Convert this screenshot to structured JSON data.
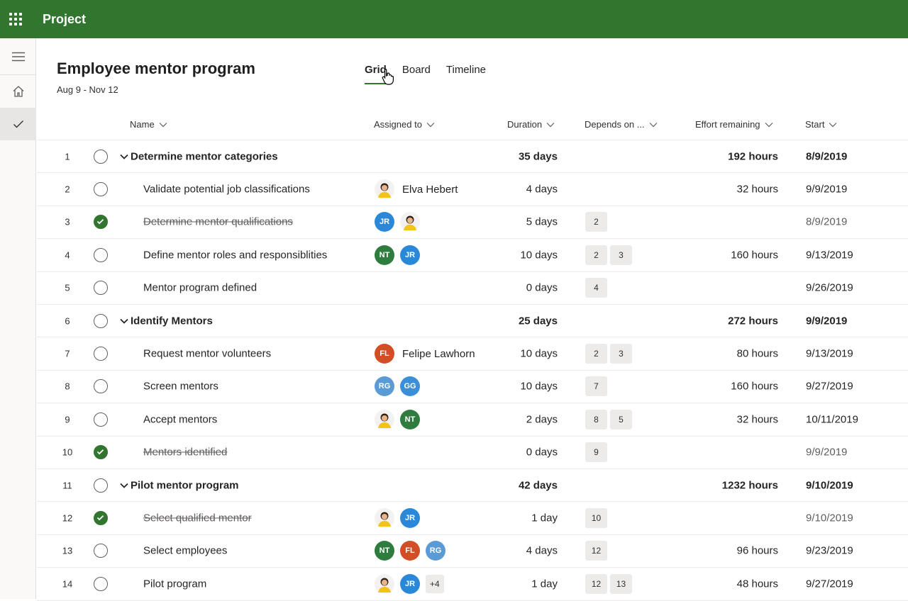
{
  "app": {
    "title": "Project"
  },
  "plan": {
    "title": "Employee mentor program",
    "dates": "Aug 9 - Nov 12"
  },
  "tabs": [
    {
      "label": "Grid",
      "active": true
    },
    {
      "label": "Board"
    },
    {
      "label": "Timeline"
    }
  ],
  "columns": {
    "name": "Name",
    "assigned": "Assigned to",
    "duration": "Duration",
    "depends": "Depends on ...",
    "effort": "Effort remaining",
    "start": "Start"
  },
  "colors": {
    "brand": "#31752f",
    "JR": "#2b88d8",
    "NT": "#2e7d3e",
    "FL": "#d14e26",
    "RG": "#5b9bd5",
    "GG": "#3a8fd8"
  },
  "rows": [
    {
      "num": "1",
      "name": "Determine mentor categories",
      "summary": true,
      "done": false,
      "assigned": [],
      "assigned_name": "",
      "duration": "35 days",
      "depends": [],
      "effort": "192 hours",
      "start": "8/9/2019"
    },
    {
      "num": "2",
      "name": "Validate potential job classifications",
      "summary": false,
      "done": false,
      "assigned": [
        "photo"
      ],
      "assigned_name": "Elva Hebert",
      "duration": "4 days",
      "depends": [],
      "effort": "32 hours",
      "start": "9/9/2019"
    },
    {
      "num": "3",
      "name": "Determine mentor qualifications",
      "summary": false,
      "done": true,
      "assigned": [
        "JR",
        "photo"
      ],
      "assigned_name": "",
      "duration": "5 days",
      "depends": [
        "2"
      ],
      "effort": "",
      "start": "8/9/2019"
    },
    {
      "num": "4",
      "name": "Define mentor roles and responsiblities",
      "summary": false,
      "done": false,
      "assigned": [
        "NT",
        "JR"
      ],
      "assigned_name": "",
      "duration": "10 days",
      "depends": [
        "2",
        "3"
      ],
      "effort": "160 hours",
      "start": "9/13/2019"
    },
    {
      "num": "5",
      "name": "Mentor program defined",
      "summary": false,
      "done": false,
      "assigned": [],
      "assigned_name": "",
      "duration": "0 days",
      "depends": [
        "4"
      ],
      "effort": "",
      "start": "9/26/2019"
    },
    {
      "num": "6",
      "name": "Identify Mentors",
      "summary": true,
      "done": false,
      "assigned": [],
      "assigned_name": "",
      "duration": "25 days",
      "depends": [],
      "effort": "272 hours",
      "start": "9/9/2019"
    },
    {
      "num": "7",
      "name": "Request mentor volunteers",
      "summary": false,
      "done": false,
      "assigned": [
        "FL"
      ],
      "assigned_name": "Felipe Lawhorn",
      "duration": "10 days",
      "depends": [
        "2",
        "3"
      ],
      "effort": "80 hours",
      "start": "9/13/2019"
    },
    {
      "num": "8",
      "name": "Screen mentors",
      "summary": false,
      "done": false,
      "assigned": [
        "RG",
        "GG"
      ],
      "assigned_name": "",
      "duration": "10 days",
      "depends": [
        "7"
      ],
      "effort": "160 hours",
      "start": "9/27/2019"
    },
    {
      "num": "9",
      "name": "Accept mentors",
      "summary": false,
      "done": false,
      "assigned": [
        "photo",
        "NT"
      ],
      "assigned_name": "",
      "duration": "2 days",
      "depends": [
        "8",
        "5"
      ],
      "effort": "32 hours",
      "start": "10/11/2019"
    },
    {
      "num": "10",
      "name": "Mentors identified",
      "summary": false,
      "done": true,
      "assigned": [],
      "assigned_name": "",
      "duration": "0 days",
      "depends": [
        "9"
      ],
      "effort": "",
      "start": "9/9/2019"
    },
    {
      "num": "11",
      "name": "Pilot mentor program",
      "summary": true,
      "done": false,
      "assigned": [],
      "assigned_name": "",
      "duration": "42 days",
      "depends": [],
      "effort": "1232 hours",
      "start": "9/10/2019"
    },
    {
      "num": "12",
      "name": "Select qualified mentor",
      "summary": false,
      "done": true,
      "assigned": [
        "photo",
        "JR"
      ],
      "assigned_name": "",
      "duration": "1 day",
      "depends": [
        "10"
      ],
      "effort": "",
      "start": "9/10/2019"
    },
    {
      "num": "13",
      "name": "Select employees",
      "summary": false,
      "done": false,
      "assigned": [
        "NT",
        "FL",
        "RG"
      ],
      "assigned_name": "",
      "duration": "4 days",
      "depends": [
        "12"
      ],
      "effort": "96 hours",
      "start": "9/23/2019"
    },
    {
      "num": "14",
      "name": "Pilot program",
      "summary": false,
      "done": false,
      "assigned": [
        "photo",
        "JR"
      ],
      "assigned_more": "+4",
      "assigned_name": "",
      "duration": "1 day",
      "depends": [
        "12",
        "13"
      ],
      "effort": "48 hours",
      "start": "9/27/2019"
    }
  ]
}
